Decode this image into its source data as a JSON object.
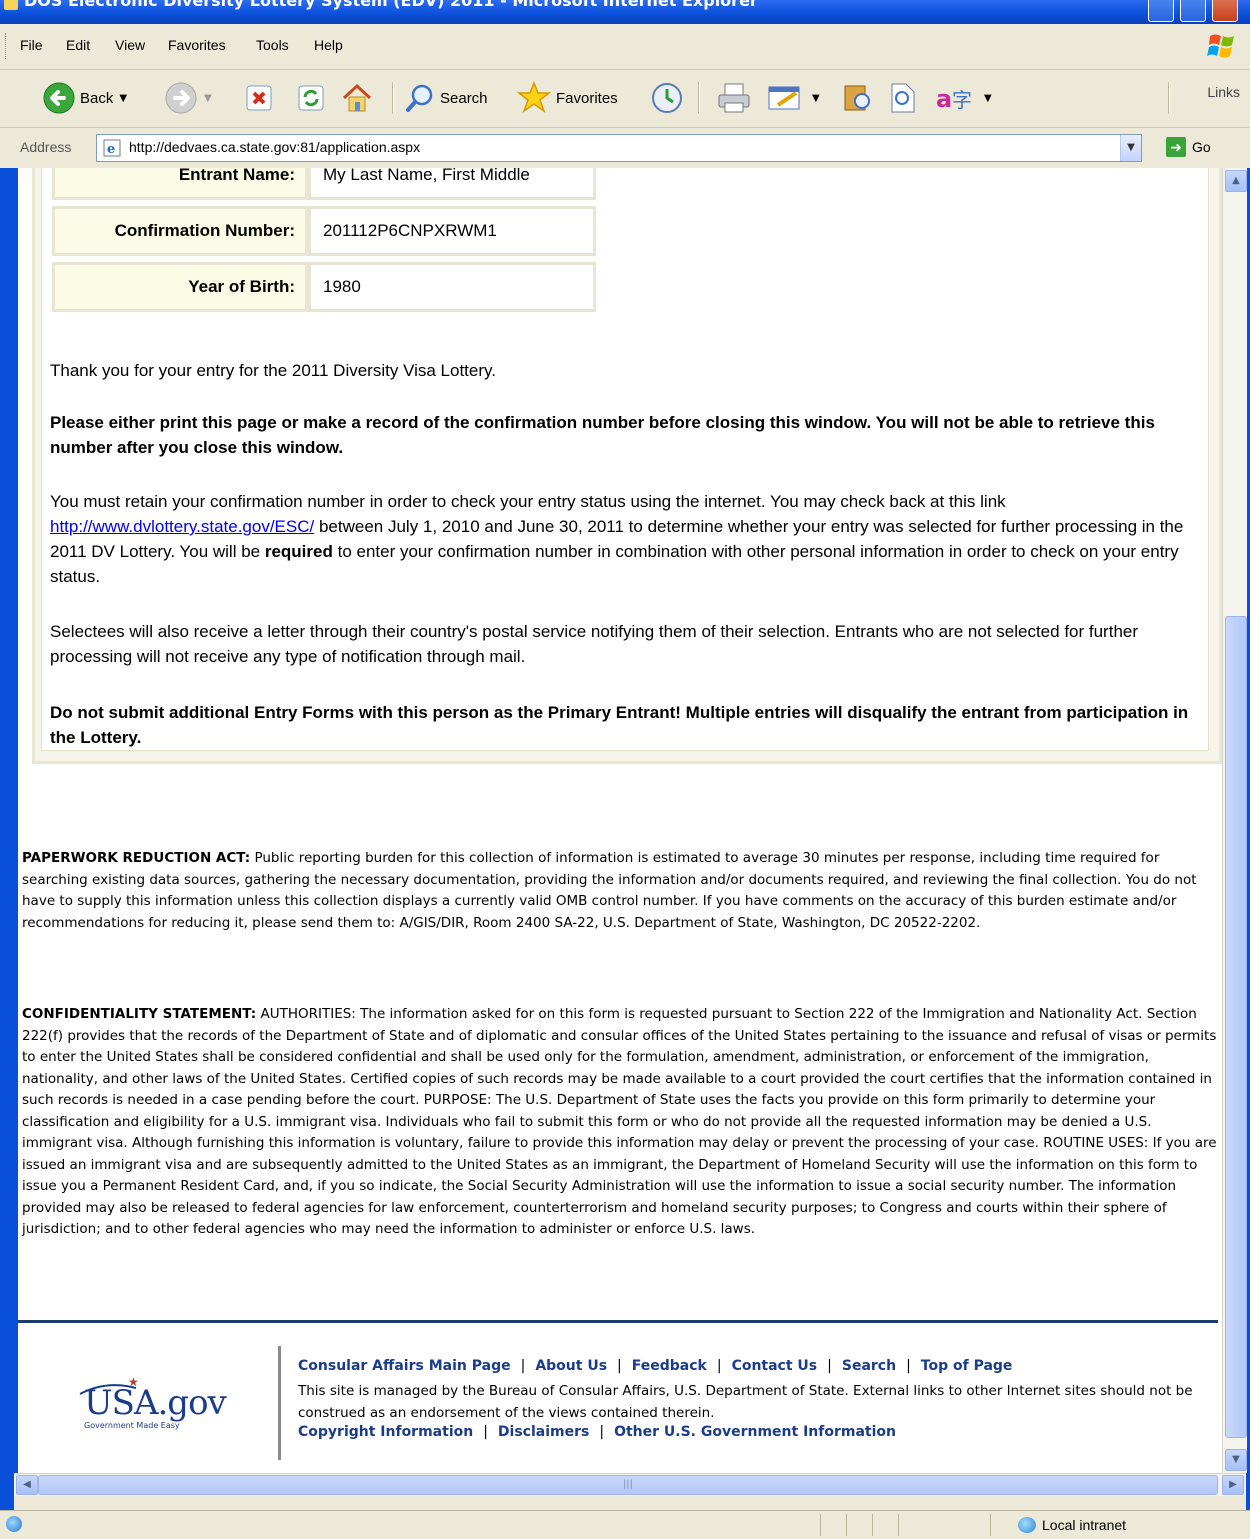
{
  "window": {
    "title": "DOS Electronic Diversity Lottery System (EDV) 2011 - Microsoft Internet Explorer"
  },
  "menu": [
    "File",
    "Edit",
    "View",
    "Favorites",
    "Tools",
    "Help"
  ],
  "toolbar": {
    "back": "Back",
    "search": "Search",
    "favorites": "Favorites",
    "links": "Links"
  },
  "address": {
    "label": "Address",
    "url": "http://dedvaes.ca.state.gov:81/application.aspx",
    "go": "Go"
  },
  "entry": {
    "rows": [
      {
        "label": "Entrant Name:",
        "value": "My Last Name, First Middle"
      },
      {
        "label": "Confirmation Number:",
        "value": "201112P6CNPXRWM1"
      },
      {
        "label": "Year of Birth:",
        "value": "1980"
      }
    ]
  },
  "body": {
    "thanks": "Thank you for your entry for the 2011 Diversity Visa Lottery.",
    "warning": "Please either print this page or make a record of the confirmation number before closing this window. You will not be able to retrieve this number after you close this window.",
    "retain_pre": "You must retain your confirmation number in order to check your entry status using the internet. You may check back at this link ",
    "retain_link": "http://www.dvlottery.state.gov/ESC/",
    "retain_mid": " between July 1, 2010 and June 30, 2011 to determine whether your entry was selected for further processing in the 2011 DV Lottery. You will be ",
    "retain_bold": "required",
    "retain_post": " to enter your confirmation number in combination with other personal information in order to check on your entry status.",
    "selectees": "Selectees will also receive a letter through their country's postal service notifying them of their selection. Entrants who are not selected for further processing will not receive any type of notification through mail.",
    "do_not_submit": "Do not submit additional Entry Forms with this person as the Primary Entrant! Multiple entries will disqualify the entrant from participation in the Lottery."
  },
  "legal": {
    "paperwork_title": "PAPERWORK REDUCTION ACT:",
    "paperwork_text": " Public reporting burden for this collection of information is estimated to average 30 minutes per response, including time required for searching existing data sources, gathering the necessary documentation, providing the information and/or documents required, and reviewing the final collection. You do not have to supply this information unless this collection displays a currently valid OMB control number. If you have comments on the accuracy of this burden estimate and/or recommendations for reducing it, please send them to: A/GIS/DIR, Room 2400 SA-22, U.S. Department of State, Washington, DC 20522-2202.",
    "confidentiality_title": "CONFIDENTIALITY STATEMENT:",
    "confidentiality_text": " AUTHORITIES: The information asked for on this form is requested pursuant to Section 222 of the Immigration and Nationality Act. Section 222(f) provides that the records of the Department of State and of diplomatic and consular offices of the United States pertaining to the issuance and refusal of visas or permits to enter the United States shall be considered confidential and shall be used only for the formulation, amendment, administration, or enforcement of the immigration, nationality, and other laws of the United States. Certified copies of such records may be made available to a court provided the court certifies that the information contained in such records is needed in a case pending before the court. PURPOSE: The U.S. Department of State uses the facts you provide on this form primarily to determine your classification and eligibility for a U.S. immigrant visa. Individuals who fail to submit this form or who do not provide all the requested information may be denied a U.S. immigrant visa. Although furnishing this information is voluntary, failure to provide this information may delay or prevent the processing of your case. ROUTINE USES: If you are issued an immigrant visa and are subsequently admitted to the United States as an immigrant, the Department of Homeland Security will use the information on this form to issue you a Permanent Resident Card, and, if you so indicate, the Social Security Administration will use the information to issue a social security number. The information provided may also be released to federal agencies for law enforcement, counterterrorism and homeland security purposes; to Congress and courts within their sphere of jurisdiction; and to other federal agencies who may need the information to administer or enforce U.S. laws."
  },
  "footer": {
    "logo_text": "USA.gov",
    "logo_tagline": "Government Made Easy",
    "links": [
      "Consular Affairs Main Page",
      "About Us",
      "Feedback",
      "Contact Us",
      "Search",
      "Top of Page"
    ],
    "managed": "This site is managed by the Bureau of Consular Affairs, U.S. Department of State. External links to other Internet sites should not be construed as an endorsement of the views contained therein.",
    "links2": [
      "Copyright Information",
      "Disclaimers",
      "Other U.S. Government Information"
    ]
  },
  "status": {
    "zone": "Local intranet"
  }
}
